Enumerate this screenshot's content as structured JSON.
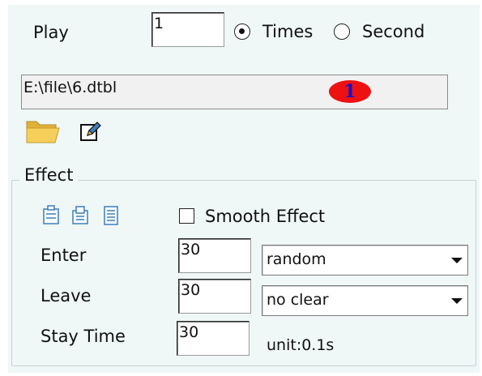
{
  "play": {
    "label": "Play",
    "count_value": "1",
    "options": [
      {
        "label": "Times",
        "selected": true
      },
      {
        "label": "Second",
        "selected": false
      }
    ]
  },
  "file": {
    "path": "E:\\file\\6.dtbl",
    "badge": "1",
    "badge_color": "#ee1111"
  },
  "toolbar": {
    "icons": [
      "folder-open-icon",
      "edit-icon"
    ]
  },
  "effect": {
    "group_title": "Effect",
    "icons": [
      "align-top-icon",
      "align-center-icon",
      "list-icon"
    ],
    "smooth_effect_label": "Smooth Effect",
    "smooth_effect_checked": false,
    "enter": {
      "label": "Enter",
      "value": "30",
      "mode": "random"
    },
    "leave": {
      "label": "Leave",
      "value": "30",
      "mode": "no clear"
    },
    "stay": {
      "label": "Stay Time",
      "value": "30",
      "unit": "unit:0.1s"
    }
  },
  "colors": {
    "panel_bg": "#eff7f7",
    "icon_blue": "#3f7fb8",
    "folder_yellow": "#f2c94c"
  }
}
